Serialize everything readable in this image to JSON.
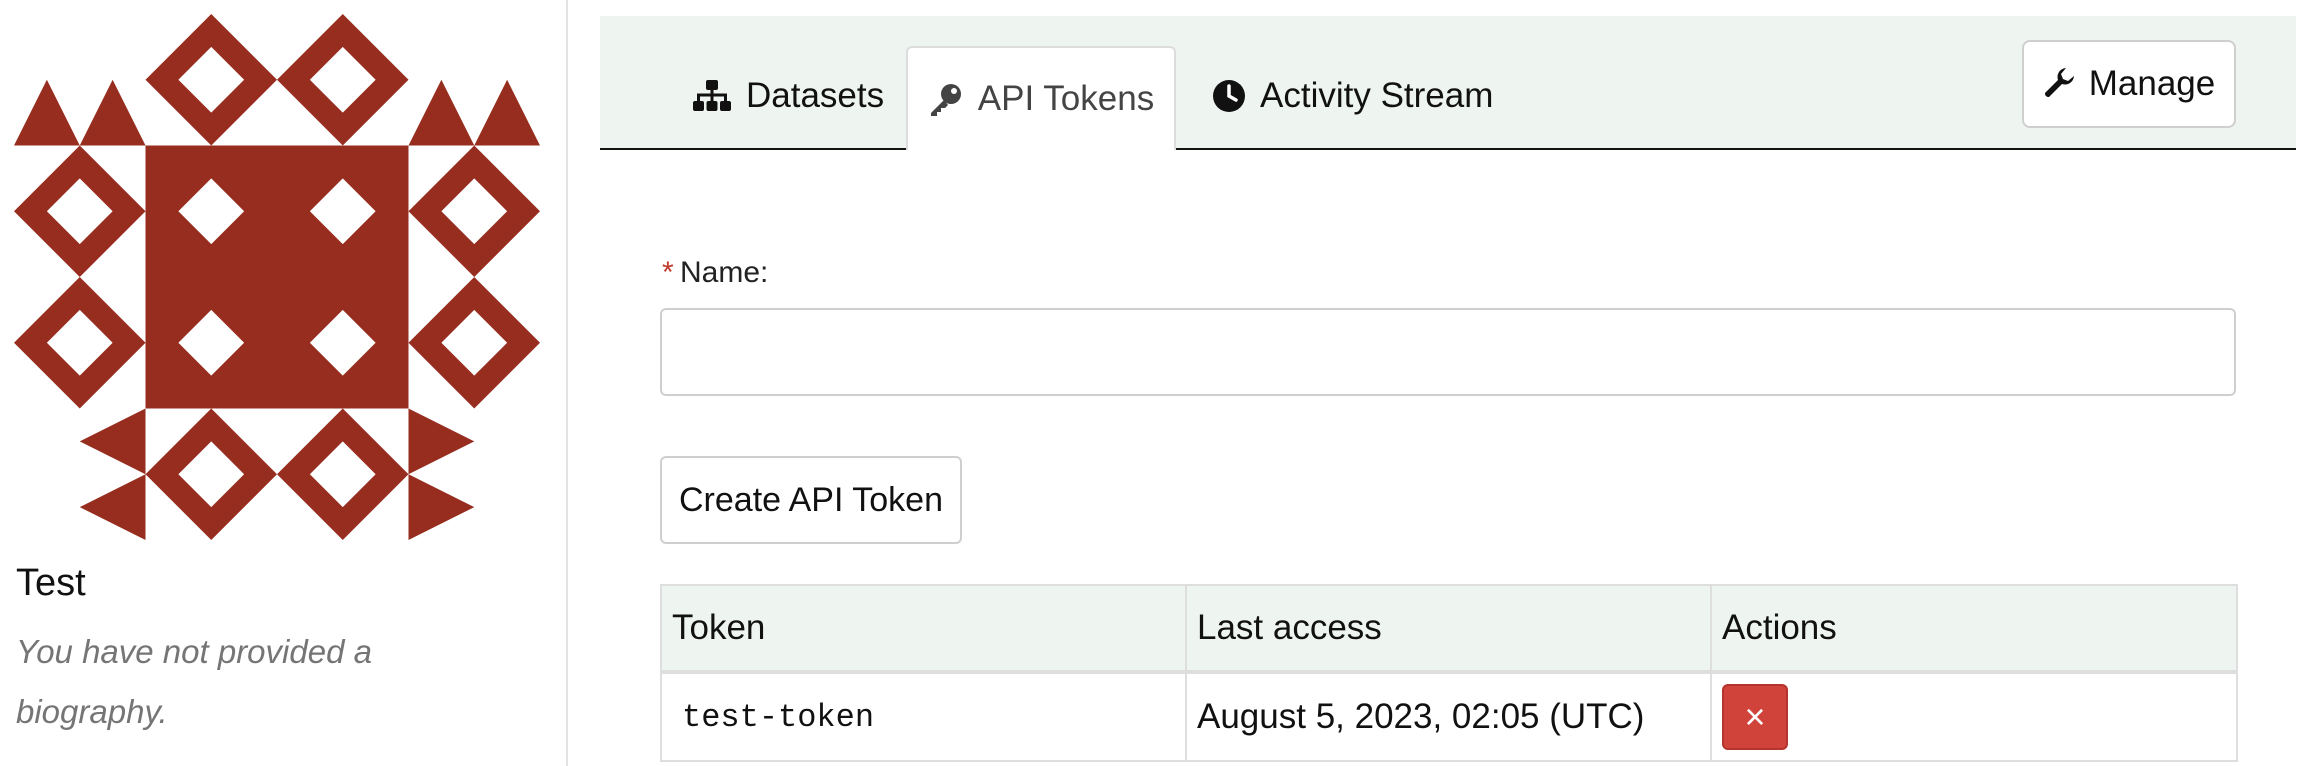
{
  "sidebar": {
    "user_name": "Test",
    "bio": "You have not provided a biography.",
    "avatar_color": "#962d1f"
  },
  "tabs": [
    {
      "label": "Datasets",
      "icon": "sitemap-icon",
      "active": false
    },
    {
      "label": "API Tokens",
      "icon": "key-icon",
      "active": true
    },
    {
      "label": "Activity Stream",
      "icon": "clock-icon",
      "active": false
    }
  ],
  "manage": {
    "label": "Manage",
    "icon": "wrench-icon"
  },
  "form": {
    "required_mark": "*",
    "name_label": "Name:",
    "name_value": "",
    "create_label": "Create API Token"
  },
  "table": {
    "headers": [
      "Token",
      "Last access",
      "Actions"
    ],
    "rows": [
      {
        "token": "test-token",
        "last_access": "August 5, 2023, 02:05 (UTC)",
        "action_icon": "×"
      }
    ]
  },
  "colors": {
    "tab_bar_bg": "#eef5f0",
    "danger": "#d0433a",
    "required": "#c0392b"
  }
}
